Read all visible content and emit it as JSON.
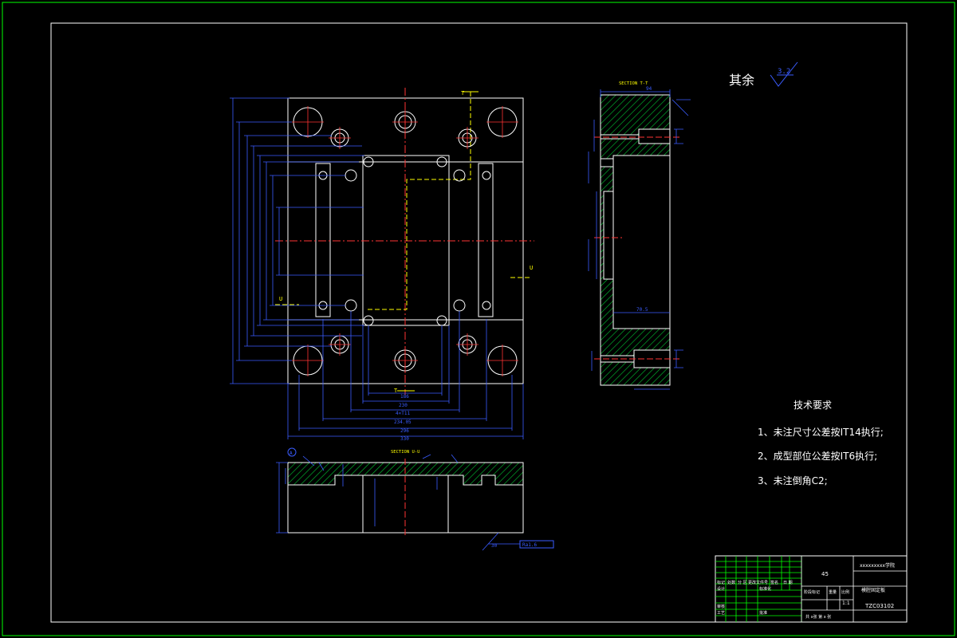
{
  "surface_note": {
    "text": "其余",
    "roughness": "3.2"
  },
  "tech_requirements": {
    "title": "技术要求",
    "items": [
      "1、未注尺寸公差按IT14执行;",
      "2、成型部位公差按IT6执行;",
      "3、未注倒角C2;"
    ]
  },
  "sections": {
    "t": "SECTION T-T",
    "u": "SECTION U-U"
  },
  "cut_labels": {
    "t": "T",
    "u": "U"
  },
  "plan_dims": {
    "h": [
      "186",
      "230",
      "4×T11",
      "234.05",
      "296",
      "330"
    ],
    "v": [
      "",
      "",
      "",
      "",
      "",
      "",
      "",
      ""
    ]
  },
  "side_dims": {
    "b1": "70.5",
    "b2": "94"
  },
  "bottom_dims": {
    "b1": "30",
    "b2": "Ra1.6",
    "label": "A"
  },
  "title_block": {
    "school": "xxxxxxxxx学院",
    "material": "45",
    "part_name": "模腔固定板",
    "drawing_no": "TZC03102",
    "scale": "1:1",
    "sheet": "共 x张  第 x 张",
    "labels": [
      "标记",
      "处数",
      "分 区",
      "更改文件号",
      "签名",
      "日 期",
      "设计",
      "标准化",
      "阶段标记",
      "重量",
      "比例",
      "审核",
      "工艺",
      "批准"
    ]
  },
  "colors": {
    "frame": "#00ff00",
    "geometry": "#ffffff",
    "dimension": "#3a5cff",
    "center": "#ff3333",
    "hatch": "#00cc33",
    "cut": "#ffff00"
  }
}
